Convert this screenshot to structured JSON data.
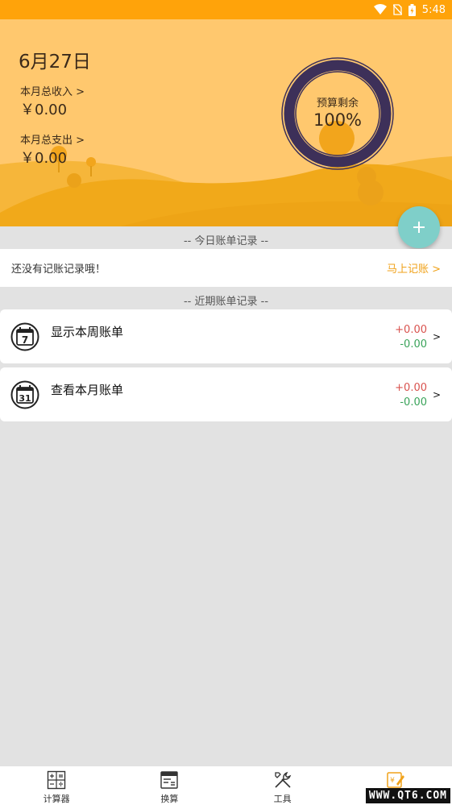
{
  "status_bar": {
    "time": "5:48"
  },
  "header": {
    "date": "6月27日",
    "income_label": "本月总收入 >",
    "income_value": "￥0.00",
    "expense_label": "本月总支出 >",
    "expense_value": "￥0.00",
    "budget_label": "预算剩余",
    "budget_value": "100%",
    "budget_fraction": 1.0
  },
  "fab": {
    "icon": "plus-icon"
  },
  "today": {
    "title": "-- 今日账单记录 --",
    "empty_text": "还没有记账记录哦！",
    "link_text": "马上记账 >"
  },
  "recent": {
    "title": "-- 近期账单记录 --",
    "cards": [
      {
        "icon_number": "7",
        "title": "显示本周账单",
        "plus": "+0.00",
        "minus": "-0.00",
        "arrow": ">"
      },
      {
        "icon_number": "31",
        "title": "查看本月账单",
        "plus": "+0.00",
        "minus": "-0.00",
        "arrow": ">"
      }
    ]
  },
  "nav": [
    {
      "label": "计算器",
      "icon": "calculator-icon"
    },
    {
      "label": "换算",
      "icon": "converter-icon"
    },
    {
      "label": "工具",
      "icon": "tools-icon"
    },
    {
      "label": "",
      "icon": "bookkeeping-icon"
    }
  ],
  "watermark": "WWW.QT6.COM",
  "colors": {
    "status_bar": "#ffa30a",
    "header_bg": "#ffc86e",
    "hill": "#f1a91a",
    "ring": "#3d3059",
    "fab": "#7fcfc9",
    "income": "#d9534f",
    "expense": "#3aa35a",
    "link": "#f0a21a"
  }
}
